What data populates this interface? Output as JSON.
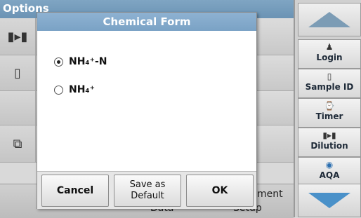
{
  "background": {
    "title": "Options",
    "bottom_labels": [
      "Data",
      "Setup",
      "ment"
    ]
  },
  "sidebar": {
    "login": "Login",
    "sample_id": "Sample ID",
    "timer": "Timer",
    "dilution": "Dilution",
    "aqa": "AQA"
  },
  "dialog": {
    "title": "Chemical Form",
    "options": [
      {
        "label": "NH₄⁺-N",
        "selected": true
      },
      {
        "label": "NH₄⁺",
        "selected": false
      }
    ],
    "buttons": {
      "cancel": "Cancel",
      "save_line1": "Save as",
      "save_line2": "Default",
      "ok": "OK"
    }
  },
  "colors": {
    "title_blue": "#7aa2c5",
    "arrow_down": "#4a91c9"
  }
}
